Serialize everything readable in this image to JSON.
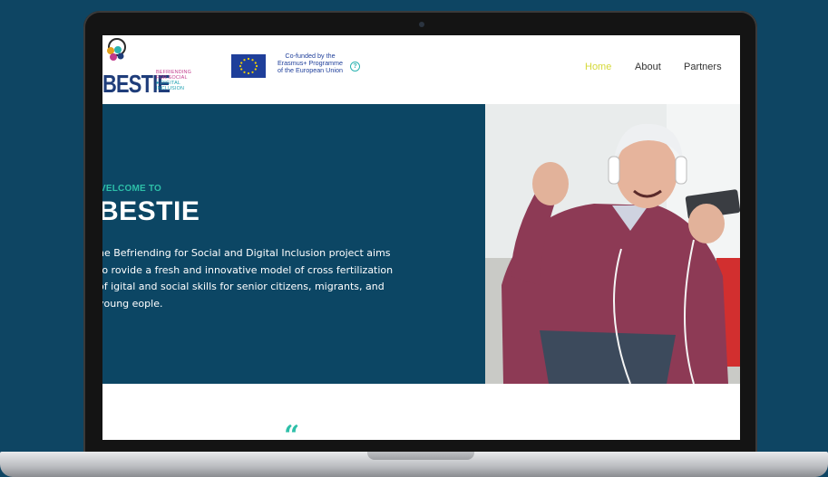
{
  "brand": {
    "name": "BESTIE",
    "tagline": [
      "BEFRIENDING",
      "FOR SOCIAL",
      "DIGITAL",
      "INCLUSION"
    ]
  },
  "eu": {
    "text": [
      "Co-funded by the",
      "Erasmus+ Programme",
      "of the European Union"
    ]
  },
  "nav": {
    "items": [
      {
        "label": "Home",
        "active": true
      },
      {
        "label": "About",
        "active": false
      },
      {
        "label": "Partners",
        "active": false
      }
    ]
  },
  "hero": {
    "kicker": "VELCOME TO",
    "title": "BESTIE",
    "description": "he Befriending for Social and Digital Inclusion project aims to rovide a fresh and innovative model of cross fertilization of igital and social skills for senior citizens, migrants, and young eople."
  },
  "quote": {
    "mark": "“",
    "text": "... ... ... ... ... ... ... ... ..."
  },
  "colors": {
    "background": "#0e4563",
    "hero": "#0c4664",
    "accent": "#2dbfa8",
    "nav_active": "#d5d93a",
    "brand_blue": "#1f3d7a",
    "brand_pink": "#c13b8c"
  },
  "icons": [
    "bestie-logo-icon",
    "eu-flag-icon",
    "help-icon",
    "quote-icon"
  ]
}
